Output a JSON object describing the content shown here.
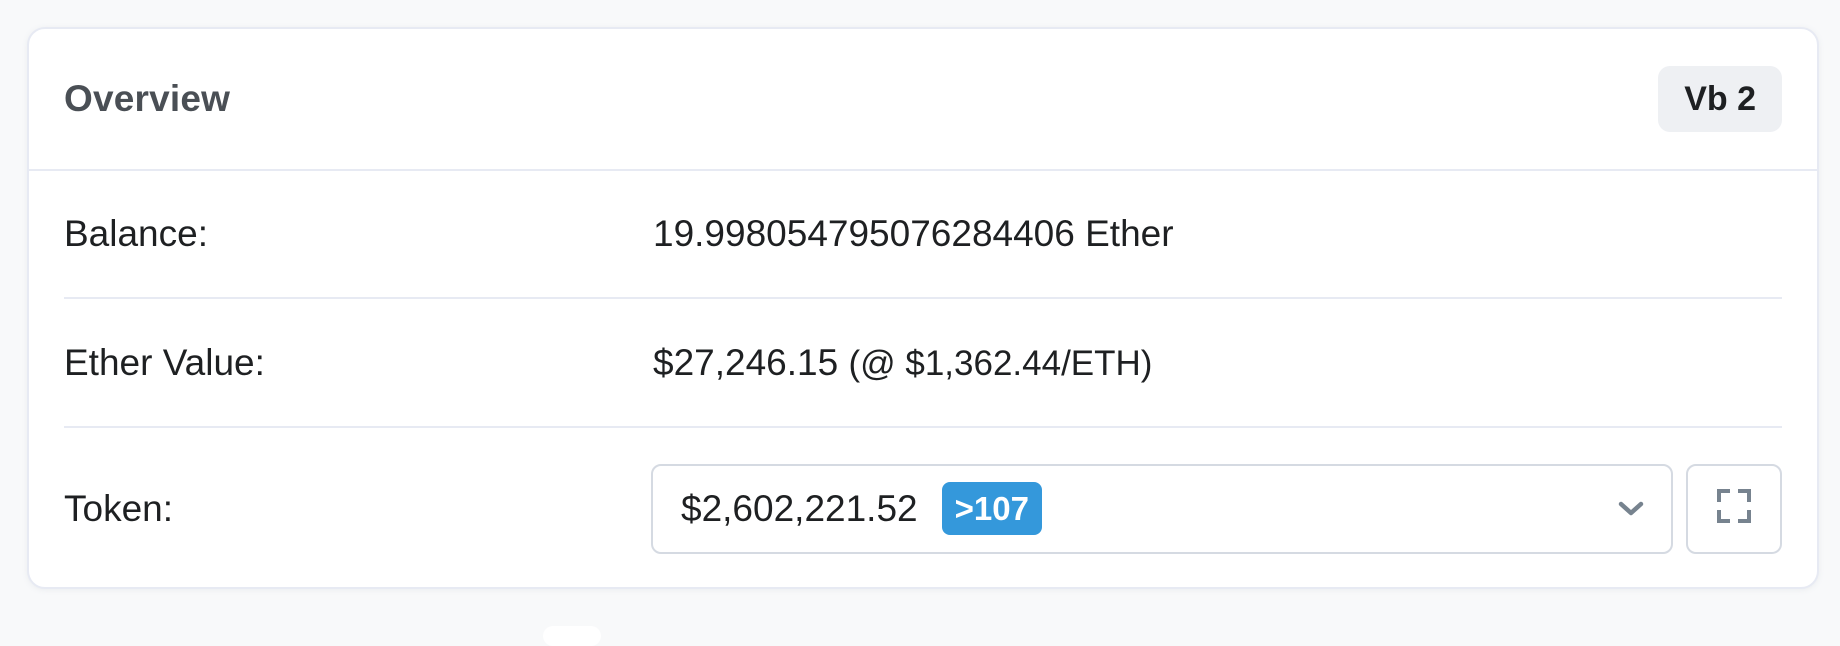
{
  "overview": {
    "title": "Overview",
    "version_badge": "Vb 2"
  },
  "rows": {
    "balance": {
      "label": "Balance:",
      "value": "19.998054795076284406 Ether"
    },
    "ether_value": {
      "label": "Ether Value:",
      "amount": "$27,246.15",
      "rate": "(@ $1,362.44/ETH)"
    },
    "token": {
      "label": "Token:",
      "amount": "$2,602,221.52",
      "count_badge": ">107"
    }
  },
  "icons": {
    "dropdown": "chevron-down-icon",
    "expand": "expand-icon"
  },
  "colors": {
    "badge_blue": "#3498db",
    "border": "#e7eaf3",
    "title": "#4a4f55"
  }
}
